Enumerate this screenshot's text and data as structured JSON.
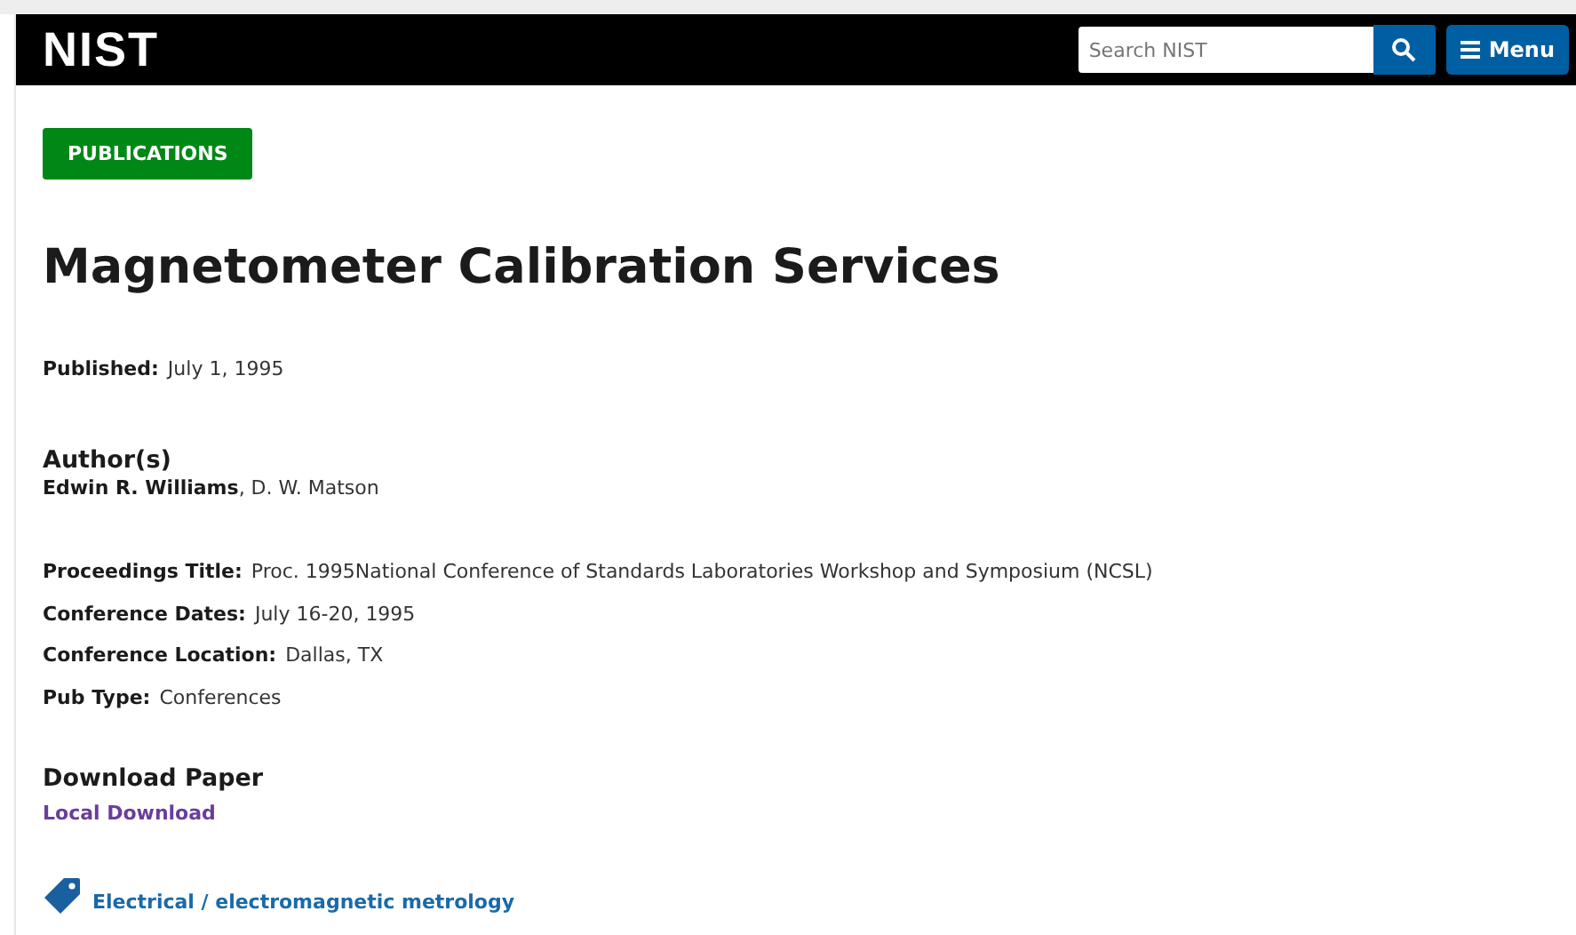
{
  "header": {
    "logo": "NIST",
    "search": {
      "placeholder": "Search NIST"
    },
    "menu_button": "Menu"
  },
  "badge": "PUBLICATIONS",
  "title": "Magnetometer Calibration Services",
  "published": {
    "label": "Published:",
    "value": "July 1, 1995"
  },
  "authors": {
    "heading": "Author(s)",
    "names": "**Edwin R. Williams**, D. W. Matson"
  },
  "details": [
    {
      "label": "Proceedings Title:",
      "value": "Proc. 1995National Conference of Standards Laboratories Workshop and Symposium (NCSL)"
    },
    {
      "label": "Conference Dates:",
      "value": "July 16-20, 1995"
    },
    {
      "label": "Conference Location:",
      "value": "Dallas, TX"
    },
    {
      "label": "Pub Type:",
      "value": "Conferences"
    }
  ],
  "download": {
    "heading": "Download Paper",
    "link": "Local Download"
  },
  "tags": [
    "Electrical / electromagnetic metrology"
  ]
}
